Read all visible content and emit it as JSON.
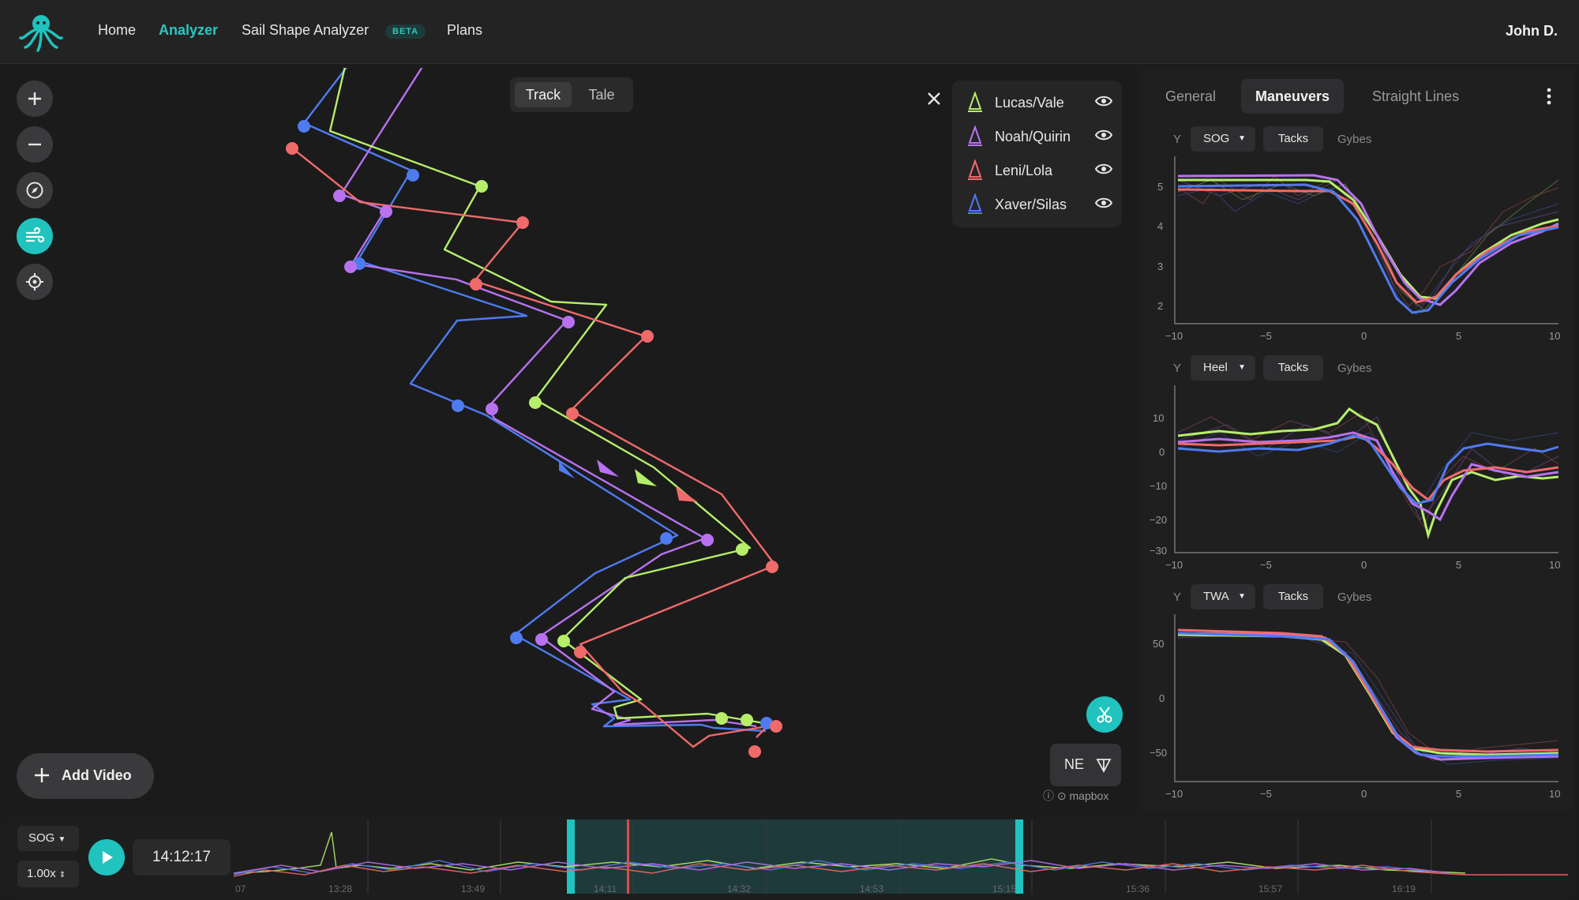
{
  "nav": {
    "items": [
      "Home",
      "Analyzer",
      "Sail Shape Analyzer",
      "Plans"
    ],
    "active": "Analyzer",
    "beta_badge": "BETA",
    "user": "John D."
  },
  "map": {
    "toggle": {
      "track": "Track",
      "tale": "Tale",
      "selected": "Track"
    },
    "legend": [
      {
        "name": "Lucas/Vale",
        "color": "#b6ee6a"
      },
      {
        "name": "Noah/Quirin",
        "color": "#b872f0"
      },
      {
        "name": "Leni/Lola",
        "color": "#f06a6a"
      },
      {
        "name": "Xaver/Silas",
        "color": "#4f7bf0"
      }
    ],
    "wind_direction": "NE",
    "attribution": "mapbox",
    "add_video": "Add Video",
    "controls": [
      "zoom-in-icon",
      "zoom-out-icon",
      "compass-icon",
      "wind-icon",
      "locate-icon"
    ]
  },
  "panel": {
    "tabs": [
      "General",
      "Maneuvers",
      "Straight Lines"
    ],
    "active_tab": "Maneuvers",
    "charts": [
      {
        "y_label": "Y",
        "metric": "SOG",
        "tacks": "Tacks",
        "gybes": "Gybes",
        "yticks": [
          "5",
          "4",
          "3",
          "2"
        ],
        "xticks": [
          "−10",
          "−5",
          "0",
          "5",
          "10"
        ]
      },
      {
        "y_label": "Y",
        "metric": "Heel",
        "tacks": "Tacks",
        "gybes": "Gybes",
        "yticks": [
          "10",
          "0",
          "−10",
          "−20",
          "−30"
        ],
        "xticks": [
          "−10",
          "−5",
          "0",
          "5",
          "10"
        ]
      },
      {
        "y_label": "Y",
        "metric": "TWA",
        "tacks": "Tacks",
        "gybes": "Gybes",
        "yticks": [
          "50",
          "0",
          "−50"
        ],
        "xticks": [
          "−10",
          "−5",
          "0",
          "5",
          "10"
        ]
      }
    ]
  },
  "bottom": {
    "metric": "SOG",
    "speed": "1.00x",
    "time": "14:12:17",
    "ticks": [
      "07",
      "13:28",
      "13:49",
      "14:11",
      "14:32",
      "14:53",
      "15:15",
      "15:36",
      "15:57",
      "16:19"
    ]
  },
  "colors": {
    "accent": "#20c3be",
    "lucas": "#b6ee6a",
    "noah": "#b872f0",
    "leni": "#f06a6a",
    "xaver": "#4f7bf0"
  }
}
